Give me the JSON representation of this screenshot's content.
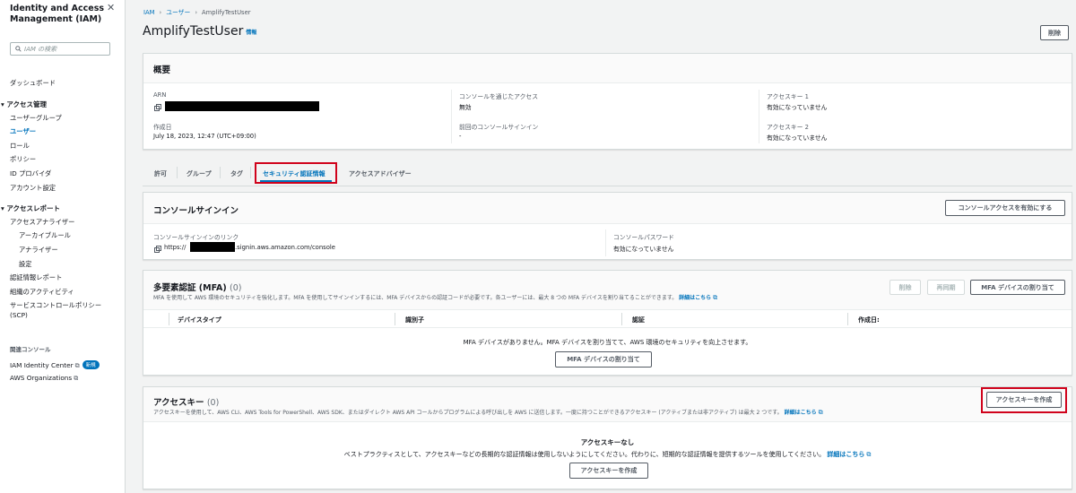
{
  "sidebar": {
    "title": "Identity and Access Management (IAM)",
    "search_placeholder": "IAM の検索",
    "dashboard": "ダッシュボード",
    "access_management": {
      "heading": "アクセス管理",
      "items": [
        "ユーザーグループ",
        "ユーザー",
        "ロール",
        "ポリシー",
        "ID プロバイダ",
        "アカウント設定"
      ]
    },
    "access_reports": {
      "heading": "アクセスレポート",
      "analyzer": "アクセスアナライザー",
      "analyzer_items": [
        "アーカイブルール",
        "アナライザー",
        "設定"
      ],
      "items": [
        "認証情報レポート",
        "組織のアクティビティ",
        "サービスコントロールポリシー",
        "(SCP)"
      ]
    },
    "related": {
      "heading": "関連コンソール",
      "identity_center": "IAM Identity Center",
      "new_badge": "新規",
      "organizations": "AWS Organizations"
    }
  },
  "breadcrumb": [
    "IAM",
    "ユーザー",
    "AmplifyTestUser"
  ],
  "page": {
    "title": "AmplifyTestUser",
    "info": "情報",
    "delete_button": "削除"
  },
  "summary": {
    "heading": "概要",
    "arn_label": "ARN",
    "created_label": "作成日",
    "created_value": "July 18, 2023, 12:47 (UTC+09:00)",
    "console_access_label": "コンソールを通じたアクセス",
    "console_access_value": "無効",
    "last_signin_label": "前回のコンソールサインイン",
    "last_signin_value": "-",
    "key1_label": "アクセスキー 1",
    "key1_value": "有効になっていません",
    "key2_label": "アクセスキー 2",
    "key2_value": "有効になっていません"
  },
  "tabs": [
    "許可",
    "グループ",
    "タグ",
    "セキュリティ認証情報",
    "アクセスアドバイザー"
  ],
  "console_signin": {
    "heading": "コンソールサインイン",
    "enable_button": "コンソールアクセスを有効にする",
    "link_label": "コンソールサインインのリンク",
    "link_prefix": "https://",
    "link_suffix": ".signin.aws.amazon.com/console",
    "password_label": "コンソールパスワード",
    "password_value": "有効になっていません"
  },
  "mfa": {
    "heading": "多要素認証 (MFA)",
    "count": "(0)",
    "description": "MFA を使用して AWS 環境のセキュリティを強化します。MFA を使用してサインインするには、MFA デバイスからの認証コードが必要です。各ユーザーには、最大 8 つの MFA デバイスを割り当てることができます。",
    "learn_more": "詳細はこちら",
    "delete_button": "削除",
    "resync_button": "再同期",
    "assign_button": "MFA デバイスの割り当て",
    "columns": [
      "デバイスタイプ",
      "識別子",
      "認証",
      "作成日:"
    ],
    "empty_message": "MFA デバイスがありません。MFA デバイスを割り当てて、AWS 環境のセキュリティを向上させます。",
    "empty_assign_button": "MFA デバイスの割り当て"
  },
  "access_keys": {
    "heading": "アクセスキー",
    "count": "(0)",
    "description": "アクセスキーを使用して、AWS CLI、AWS Tools for PowerShell、AWS SDK、またはダイレクト AWS API コールからプログラムによる呼び出しを AWS に送信します。一度に持つことができるアクセスキー (アクティブまたは非アクティブ) は最大 2 つです。",
    "learn_more": "詳細はこちら",
    "create_button": "アクセスキーを作成",
    "empty_title": "アクセスキーなし",
    "empty_message": "ベストプラクティスとして、アクセスキーなどの長期的な認証情報は使用しないようにしてください。代わりに、短期的な認証情報を提供するツールを使用してください。",
    "empty_learn_more": "詳細はこちら",
    "empty_create_button": "アクセスキーを作成"
  },
  "colors": {
    "link": "#0073bb",
    "highlight": "#d0021b"
  }
}
